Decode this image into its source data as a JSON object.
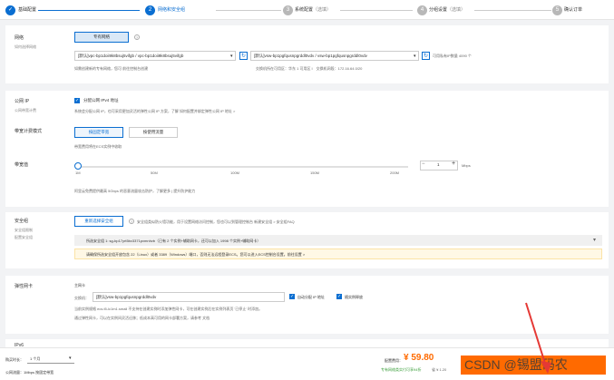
{
  "steps": [
    {
      "num": "✓",
      "label": "基础配置",
      "optional": "",
      "color": "#0a6ed1"
    },
    {
      "num": "2",
      "label": "网络和安全组",
      "optional": "",
      "color": "#0a6ed1"
    },
    {
      "num": "3",
      "label": "系统配置",
      "optional": "（选填）",
      "color": "#b8b8b8"
    },
    {
      "num": "4",
      "label": "分组设置",
      "optional": "（选填）",
      "color": "#b8b8b8"
    },
    {
      "num": "5",
      "label": "确认订单",
      "optional": "",
      "color": "#b8b8b8"
    }
  ],
  "network": {
    "title": "网络",
    "subtitle": "如何选择网络",
    "type_button": "专有网络",
    "vpc_value": "[默认]vpc-bp1doii9k8bsuj5vifgb / vpc-bp1doii9k8bsuj5vifgb",
    "vswitch_value": "[默认]vsw-bp1pgfqusnpgrddl0vdv / vsw-bp1pgfqusnpgrddl0vdv",
    "ip_count": "可用私有IP数量 4090 个",
    "note": "如需创建新的专有网络，您可 前往控制台创建",
    "note_link": "前往控制台创建",
    "zone_note": "交换机所在可用区：华东 1 可用区 I　交换机网段：172.16.64.0/20"
  },
  "public_ip": {
    "title": "公网 IP",
    "subtitle": "公网带宽计费",
    "checkbox_label": "分配公网 IPv4 地址",
    "desc": "系统会分配公网 IP，也可采用更加灵活的弹性公网 IP 方案，了解 如何配置并绑定弹性公网 IP 地址 >",
    "billing_title": "带宽计费模式",
    "billing_options": [
      "按固定带宽",
      "按使用流量"
    ],
    "billing_note": "带宽费用将在ECS实例中收取",
    "bandwidth_title": "带宽值",
    "slider_ticks": [
      "1M",
      "50M",
      "100M",
      "150M",
      "200M"
    ],
    "bandwidth_value": "1",
    "bandwidth_unit": "Mbps",
    "ddos_note": "阿里云免费提供最高 5Gbps 的恶意流量攻击防护，了解更多 | 提升防护能力"
  },
  "security": {
    "title": "安全组",
    "subtitle1": "安全组限制",
    "subtitle2": "配置安全组",
    "reselect_button": "重新选择安全组",
    "desc": "安全组类似防火墙功能，用于设置网络访问控制，您也可以到管理控制台 新建安全组 > 安全组FAQ",
    "selected": "所选安全组 1: sg-bp17yrt5bv3371pvmnhvb（已有 2 个实例+辅助网卡，还可以加入 1998 个实例+辅助网卡）",
    "warning": "请确保所选安全组开放包含 22（Linux）或者 3389（Windows）端口，否则无法远程登录ECS。您可以进入ECS控制台设置。前往设置 >"
  },
  "eni": {
    "title": "弹性网卡",
    "primary_label": "主网卡",
    "switch_label": "交换机：",
    "switch_value": "[默认]vsw-bp1pgfqusnpgrddl0vdv",
    "auto_ip": "自动分配 IP 地址",
    "release": "随实例释放",
    "note1": "当前实例规格 ecs.t5-lc1m1.small 不支持在创建实例时添加弹性网卡，可在创建实例后在实例列表页 '已停止' 时添加。",
    "note2": "通过弹性网卡，可以在实例间灵活迁移；低成本高可用的网卡部署方案，请参考 文档"
  },
  "ipv6": {
    "title": "IPv6"
  },
  "bottom": {
    "duration_label": "购买时长：",
    "duration_value": "1 个月",
    "traffic_label": "公网流量：1Mbps 按固定带宽",
    "price_label": "配置费用：",
    "price_value": "¥ 59.80",
    "saving": "专有网络类实付可享94折",
    "saving_amount": "省 ¥ 1.20",
    "watermark": "CSDN @锡盟码农"
  }
}
